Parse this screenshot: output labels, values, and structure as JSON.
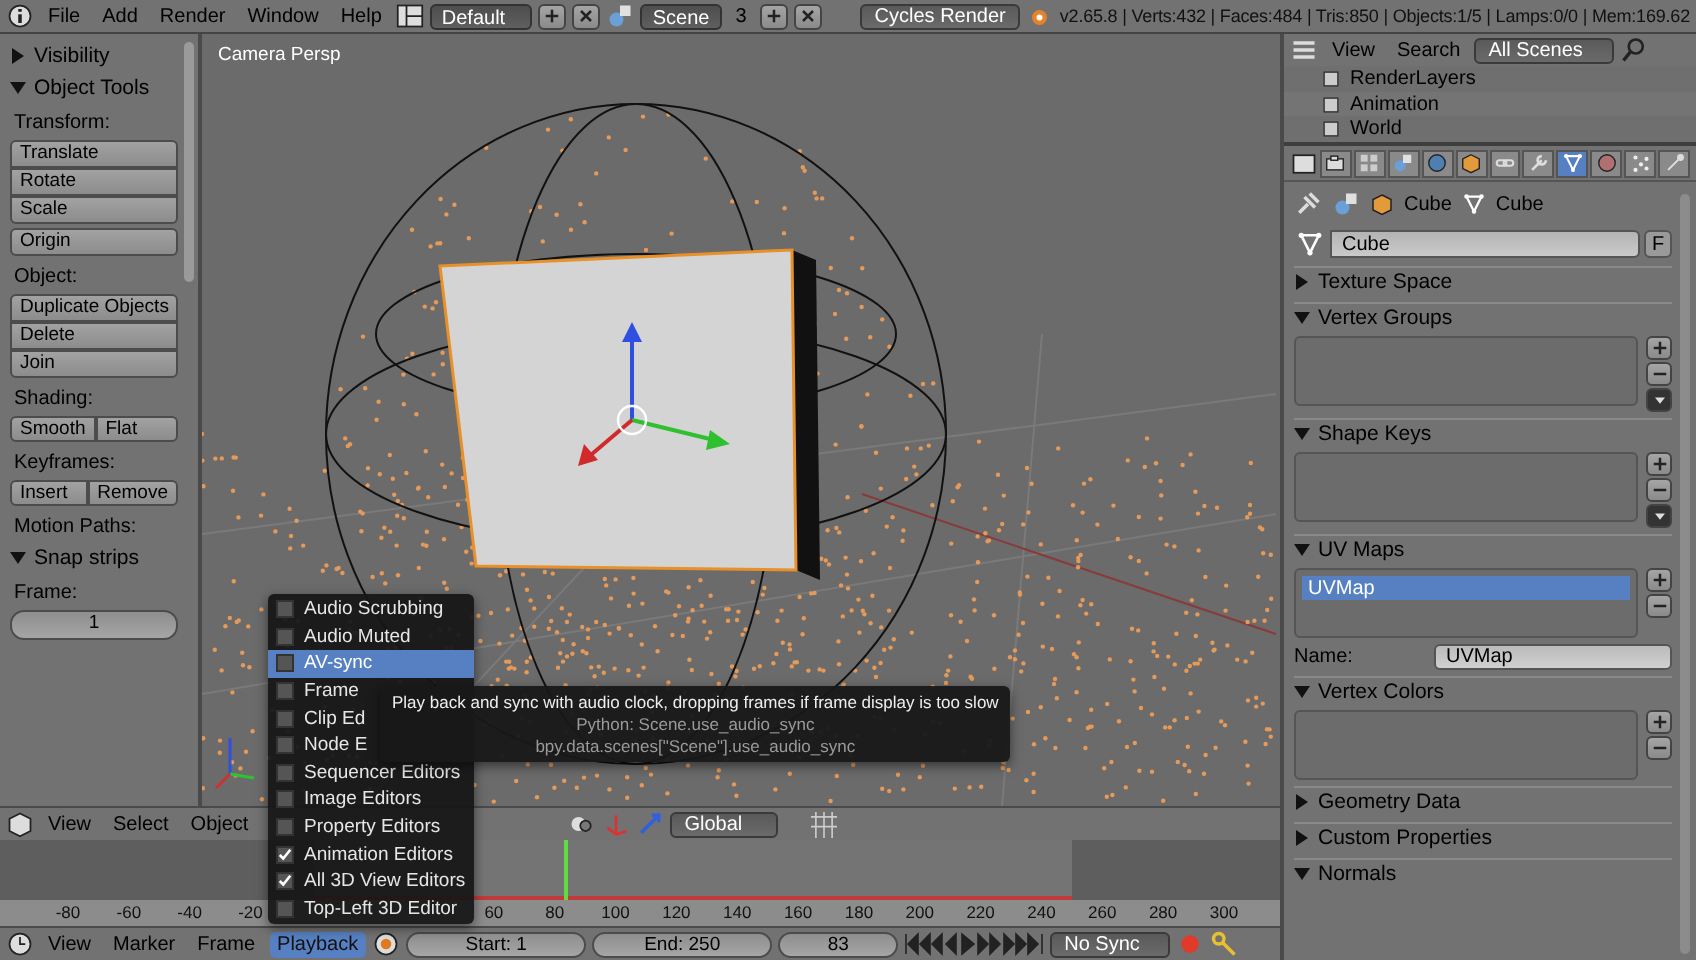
{
  "top_bar": {
    "menus": [
      "File",
      "Add",
      "Render",
      "Window",
      "Help"
    ],
    "layout": "Default",
    "scene": "Scene",
    "scene_users": "3",
    "engine": "Cycles Render",
    "stats": "v2.65.8 | Verts:432 | Faces:484 | Tris:850 | Objects:1/5 | Lamps:0/0 | Mem:169.62"
  },
  "tool_shelf": {
    "items": [
      {
        "kind": "panel",
        "text": "Visibility",
        "expanded": false
      },
      {
        "kind": "panel",
        "text": "Object Tools",
        "expanded": true
      },
      {
        "kind": "label",
        "text": "Transform:"
      },
      {
        "kind": "column",
        "labels": [
          "Translate",
          "Rotate",
          "Scale"
        ]
      },
      {
        "kind": "column",
        "labels": [
          "Origin"
        ]
      },
      {
        "kind": "label",
        "text": "Object:"
      },
      {
        "kind": "column",
        "labels": [
          "Duplicate Objects",
          "Delete",
          "Join"
        ]
      },
      {
        "kind": "label",
        "text": "Shading:"
      },
      {
        "kind": "row",
        "labels": [
          "Smooth",
          "Flat"
        ]
      },
      {
        "kind": "label",
        "text": "Keyframes:"
      },
      {
        "kind": "row",
        "labels": [
          "Insert",
          "Remove"
        ]
      },
      {
        "kind": "label",
        "text": "Motion Paths:"
      },
      {
        "kind": "panel",
        "text": "Snap strips",
        "expanded": true
      },
      {
        "kind": "label",
        "text": "Frame:"
      },
      {
        "kind": "number",
        "text": "1"
      }
    ]
  },
  "viewport": {
    "view_label": "Camera Persp"
  },
  "view3d_header": {
    "menus": [
      "View",
      "Select",
      "Object"
    ],
    "orientation": "Global"
  },
  "playback_menu": {
    "items": [
      {
        "label": "Audio Scrubbing",
        "checked": false,
        "selected": false
      },
      {
        "label": "Audio Muted",
        "checked": false,
        "selected": false
      },
      {
        "label": "AV-sync",
        "checked": false,
        "selected": true
      },
      {
        "label": "Frame",
        "checked": false,
        "selected": false
      },
      {
        "label": "Clip Ed",
        "checked": false,
        "selected": false
      },
      {
        "label": "Node E",
        "checked": false,
        "selected": false
      },
      {
        "label": "Sequencer Editors",
        "checked": false,
        "selected": false
      },
      {
        "label": "Image Editors",
        "checked": false,
        "selected": false
      },
      {
        "label": "Property Editors",
        "checked": false,
        "selected": false
      },
      {
        "label": "Animation Editors",
        "checked": true,
        "selected": false
      },
      {
        "label": "All 3D View Editors",
        "checked": true,
        "selected": false
      },
      {
        "label": "Top-Left 3D Editor",
        "checked": false,
        "selected": false
      }
    ]
  },
  "tooltip": {
    "description": "Play back and sync with audio clock, dropping frames if frame display is too slow",
    "python": "Python: Scene.use_audio_sync",
    "path": "bpy.data.scenes[\"Scene\"].use_audio_sync"
  },
  "timeline": {
    "ruler": [
      "-80",
      "-60",
      "-40",
      "-20",
      "60",
      "80",
      "100",
      "120",
      "140",
      "160",
      "180",
      "200",
      "220",
      "240",
      "260",
      "280",
      "300"
    ]
  },
  "timeline_header": {
    "menus": [
      {
        "label": "View",
        "selected": false
      },
      {
        "label": "Marker",
        "selected": false
      },
      {
        "label": "Frame",
        "selected": false
      },
      {
        "label": "Playback",
        "selected": true
      }
    ],
    "start": "Start: 1",
    "end": "End: 250",
    "current": "83",
    "sync": "No Sync"
  },
  "outliner": {
    "menus": [
      "View",
      "Search"
    ],
    "filter": "All Scenes",
    "items": [
      {
        "label": "RenderLayers"
      },
      {
        "label": "Animation"
      },
      {
        "label": "World"
      }
    ]
  },
  "properties": {
    "tabs": [
      {
        "kind": "render",
        "selected": false
      },
      {
        "kind": "layers",
        "selected": false
      },
      {
        "kind": "scene",
        "selected": false
      },
      {
        "kind": "world",
        "selected": false
      },
      {
        "kind": "object",
        "selected": false
      },
      {
        "kind": "constraints",
        "selected": false
      },
      {
        "kind": "modifiers",
        "selected": false
      },
      {
        "kind": "data",
        "selected": true
      },
      {
        "kind": "material",
        "selected": false
      },
      {
        "kind": "particles",
        "selected": false
      },
      {
        "kind": "physics",
        "selected": false
      }
    ],
    "breadcrumb": [
      "Cube",
      "Cube"
    ],
    "datablock": "Cube",
    "fake_user": "F",
    "panels": [
      {
        "title": "Texture Space",
        "expanded": false,
        "kind": "plain"
      },
      {
        "title": "Vertex Groups",
        "expanded": true,
        "kind": "list",
        "specials": true
      },
      {
        "title": "Shape Keys",
        "expanded": true,
        "kind": "list",
        "specials": true
      },
      {
        "title": "UV Maps",
        "expanded": true,
        "kind": "list",
        "specials": false,
        "items": [
          {
            "label": "UVMap",
            "selected": true
          }
        ],
        "name_label": "Name:",
        "name_value": "UVMap"
      },
      {
        "title": "Vertex Colors",
        "expanded": true,
        "kind": "list",
        "specials": false
      },
      {
        "title": "Geometry Data",
        "expanded": false,
        "kind": "plain"
      },
      {
        "title": "Custom Properties",
        "expanded": false,
        "kind": "plain"
      },
      {
        "title": "Normals",
        "expanded": true,
        "kind": "plain"
      }
    ]
  }
}
